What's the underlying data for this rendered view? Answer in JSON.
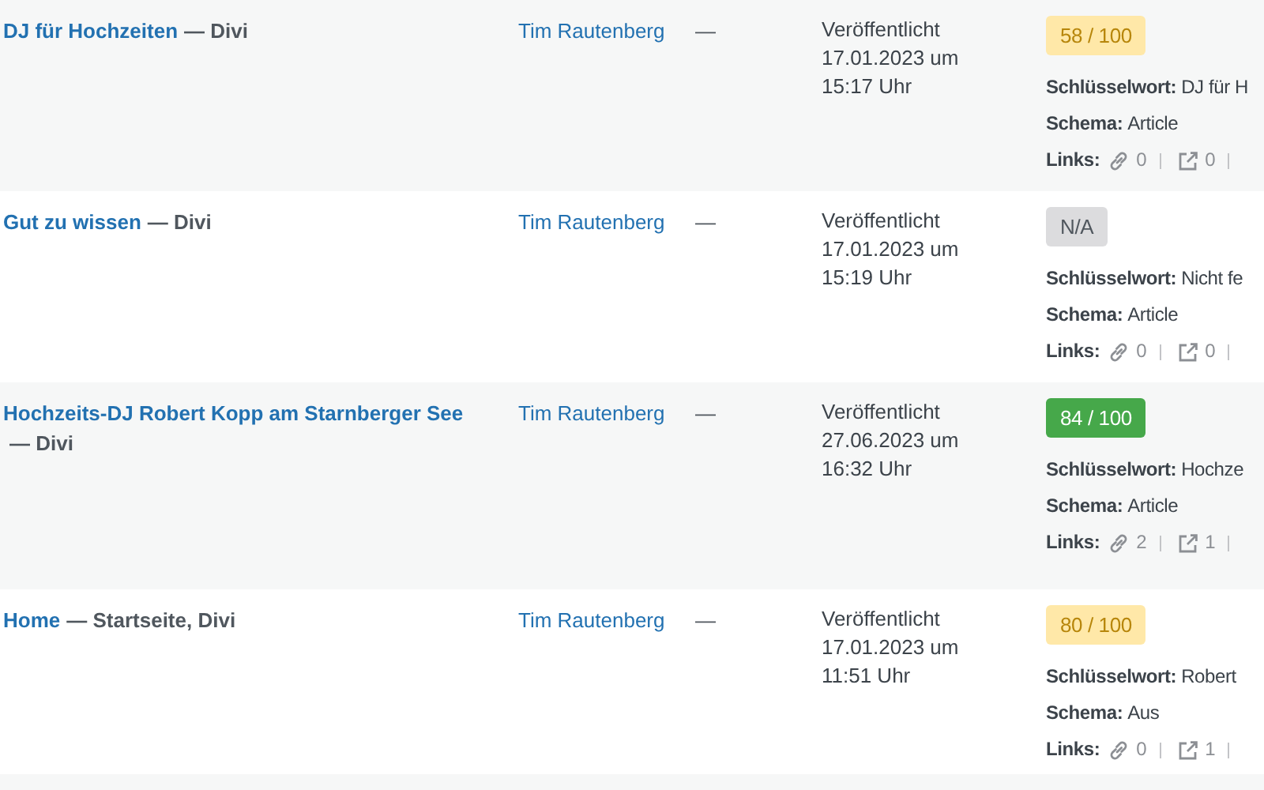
{
  "rows": [
    {
      "title": "DJ für Hochzeiten",
      "post_state": "— Divi",
      "author": "Tim Rautenberg",
      "column_3": "—",
      "status": "Veröffentlicht",
      "date": "17.01.2023 um",
      "time": "15:17 Uhr",
      "score": "58 / 100",
      "color": "#ffe8a8",
      "keyword_label": "Schlüsselwort:",
      "keyword": "DJ für H",
      "schema_label": "Schema:",
      "schema": "Article",
      "links_label": "Links:",
      "internal": "0",
      "external": "0"
    },
    {
      "title": "Gut zu wissen",
      "post_state": "— Divi",
      "author": "Tim Rautenberg",
      "column_3": "—",
      "status": "Veröffentlicht",
      "date": "17.01.2023 um",
      "time": "15:19 Uhr",
      "score": "N/A",
      "color": "#dcdcde",
      "keyword_label": "Schlüsselwort:",
      "keyword": "Nicht fe",
      "schema_label": "Schema:",
      "schema": "Article",
      "links_label": "Links:",
      "internal": "0",
      "external": "0"
    },
    {
      "title": "Hochzeits-DJ Robert Kopp am Starnberger See",
      "post_state": "— Divi",
      "author": "Tim Rautenberg",
      "column_3": "—",
      "status": "Veröffentlicht",
      "date": "27.06.2023 um",
      "time": "16:32 Uhr",
      "score": "84 / 100",
      "color": "#46a84a",
      "keyword_label": "Schlüsselwort:",
      "keyword": "Hochze",
      "schema_label": "Schema:",
      "schema": "Article",
      "links_label": "Links:",
      "internal": "2",
      "external": "1"
    },
    {
      "title": "Home",
      "post_state": "— Startseite, Divi",
      "author": "Tim Rautenberg",
      "column_3": "—",
      "status": "Veröffentlicht",
      "date": "17.01.2023 um",
      "time": "11:51 Uhr",
      "score": "80 / 100",
      "color": "#ffe8a8",
      "keyword_label": "Schlüsselwort:",
      "keyword": "Robert",
      "schema_label": "Schema:",
      "schema": "Aus",
      "links_label": "Links:",
      "internal": "0",
      "external": "1"
    }
  ]
}
